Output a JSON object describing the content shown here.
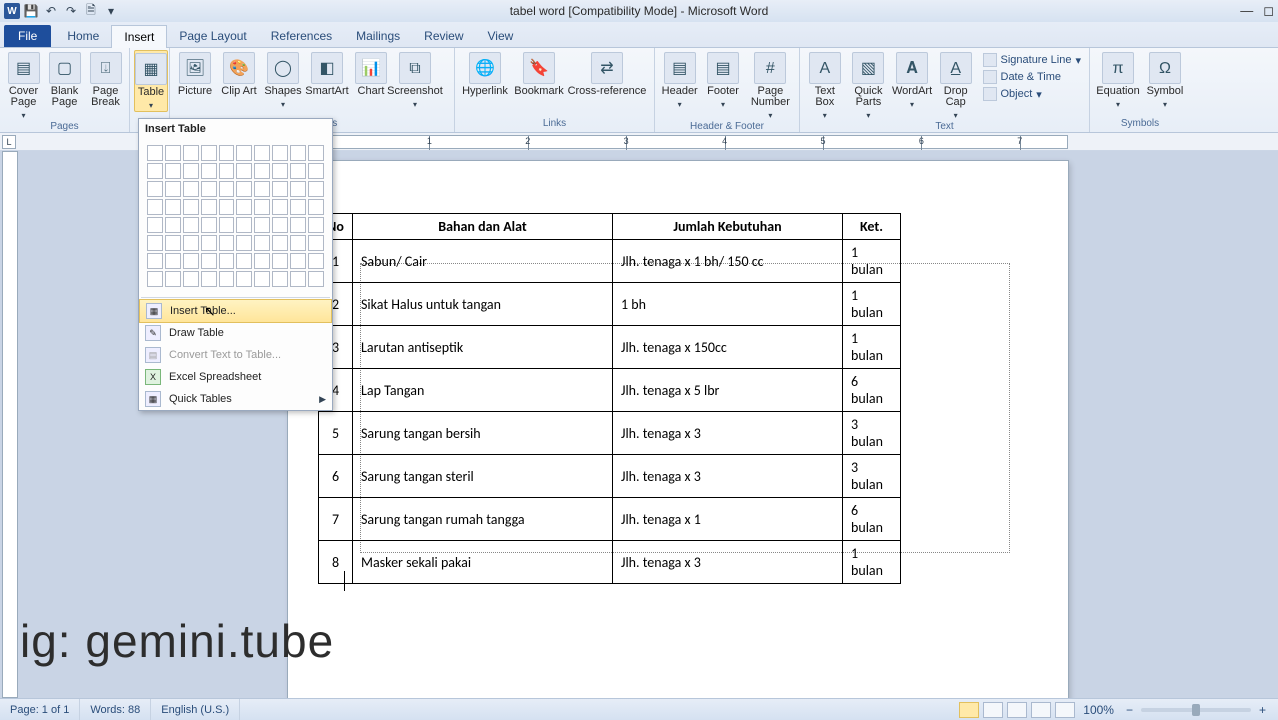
{
  "title": "tabel word [Compatibility Mode]  -  Microsoft Word",
  "tabs": {
    "file": "File",
    "home": "Home",
    "insert": "Insert",
    "pagelayout": "Page Layout",
    "references": "References",
    "mailings": "Mailings",
    "review": "Review",
    "view": "View"
  },
  "ribbon": {
    "pages": {
      "cover": "Cover Page",
      "blank": "Blank Page",
      "break": "Page Break",
      "label": "Pages"
    },
    "table_label": "Table",
    "illus": {
      "picture": "Picture",
      "clipart": "Clip Art",
      "shapes": "Shapes",
      "smartart": "SmartArt",
      "chart": "Chart",
      "screenshot": "Screenshot",
      "label_suffix": "ions"
    },
    "links": {
      "hyperlink": "Hyperlink",
      "bookmark": "Bookmark",
      "crossref": "Cross-reference",
      "label": "Links"
    },
    "hf": {
      "header": "Header",
      "footer": "Footer",
      "pagenum": "Page Number",
      "label": "Header & Footer"
    },
    "text": {
      "textbox": "Text Box",
      "quickparts": "Quick Parts",
      "wordart": "WordArt",
      "dropcap": "Drop Cap",
      "sigline": "Signature Line",
      "datetime": "Date & Time",
      "object": "Object",
      "label": "Text"
    },
    "sym": {
      "equation": "Equation",
      "symbol": "Symbol",
      "label": "Symbols"
    }
  },
  "dropdown": {
    "title": "Insert Table",
    "insert": "Insert Table...",
    "draw": "Draw Table",
    "convert": "Convert Text to Table...",
    "excel": "Excel Spreadsheet",
    "quick": "Quick Tables"
  },
  "ruler": [
    "1",
    "2",
    "3",
    "4",
    "5",
    "6",
    "7"
  ],
  "doc": {
    "headers": {
      "no": "No",
      "bahan": "Bahan dan Alat",
      "jumlah": "Jumlah Kebutuhan",
      "ket": "Ket."
    },
    "rows": [
      {
        "no": "1",
        "bahan": "Sabun/ Cair",
        "jum": "Jlh. tenaga x 1 bh/ 150 cc",
        "ket": "1 bulan"
      },
      {
        "no": "2",
        "bahan": "Sikat Halus untuk tangan",
        "jum": "1 bh",
        "ket": "1 bulan"
      },
      {
        "no": "3",
        "bahan": "Larutan antiseptik",
        "jum": "Jlh. tenaga x 150cc",
        "ket": "1 bulan"
      },
      {
        "no": "4",
        "bahan": "Lap Tangan",
        "jum": "Jlh. tenaga x 5 lbr",
        "ket": "6 bulan"
      },
      {
        "no": "5",
        "bahan": "Sarung tangan bersih",
        "jum": "Jlh. tenaga x 3",
        "ket": "3 bulan"
      },
      {
        "no": "6",
        "bahan": "Sarung tangan steril",
        "jum": "Jlh. tenaga x 3",
        "ket": "3 bulan"
      },
      {
        "no": "7",
        "bahan": "Sarung tangan rumah tangga",
        "jum": "Jlh. tenaga x 1",
        "ket": "6 bulan"
      },
      {
        "no": "8",
        "bahan": "Masker sekali pakai",
        "jum": "Jlh. tenaga x 3",
        "ket": "1 bulan"
      }
    ]
  },
  "watermark": "ig: gemini.tube",
  "status": {
    "page": "Page: 1 of 1",
    "words": "Words: 88",
    "lang": "English (U.S.)",
    "zoom": "100%"
  }
}
